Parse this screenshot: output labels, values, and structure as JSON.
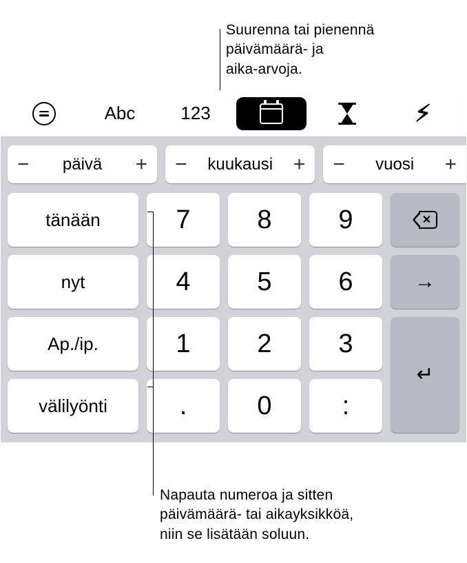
{
  "annotations": {
    "top": "Suurenna tai pienennä\npäivämäärä- ja\naika-arvoja.",
    "bottom": "Napauta numeroa ja sitten\npäivämäärä- tai aikayksikköä,\nniin se lisätään soluun."
  },
  "toolbar": {
    "text_label": "Abc",
    "number_label": "123"
  },
  "units": {
    "day": "päivä",
    "month": "kuukausi",
    "year": "vuosi",
    "minus": "−",
    "plus": "+"
  },
  "shortcuts": {
    "today": "tänään",
    "now": "nyt",
    "ampm": "Ap./ip.",
    "space": "välilyönti"
  },
  "keypad": {
    "k7": "7",
    "k8": "8",
    "k9": "9",
    "k4": "4",
    "k5": "5",
    "k6": "6",
    "k1": "1",
    "k2": "2",
    "k3": "3",
    "dot": ".",
    "k0": "0",
    "colon": ":"
  }
}
